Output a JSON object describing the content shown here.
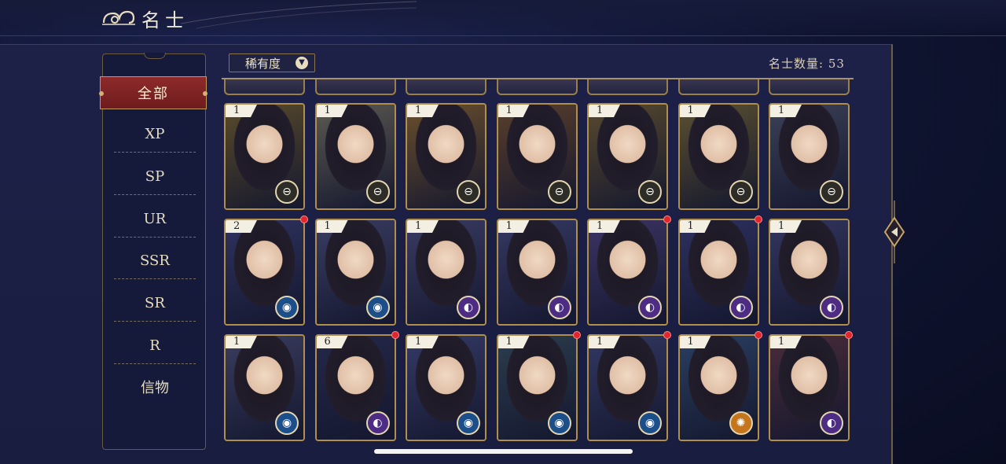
{
  "header": {
    "title": "名士"
  },
  "sidebar": {
    "items": [
      {
        "label": "全部",
        "active": true
      },
      {
        "label": "XP"
      },
      {
        "label": "SP"
      },
      {
        "label": "UR"
      },
      {
        "label": "SSR"
      },
      {
        "label": "SR"
      },
      {
        "label": "R"
      },
      {
        "label": "信物"
      }
    ]
  },
  "toolbar": {
    "sort_label": "稀有度",
    "count_label": "名士数量:",
    "count_value": "53"
  },
  "colors": {
    "accent_gold": "#b08f4d",
    "active_tab": "#8e2a2a",
    "notification": "#e3262d",
    "background": "#191d40"
  },
  "cards": [
    {
      "level": "1",
      "badge": "gold",
      "badge_icon": "sword-emblem-icon",
      "new": false,
      "tone": "#5a4b2a"
    },
    {
      "level": "1",
      "badge": "gold",
      "badge_icon": "sword-emblem-icon",
      "new": false,
      "tone": "#5c5a52"
    },
    {
      "level": "1",
      "badge": "gold",
      "badge_icon": "sword-emblem-icon",
      "new": false,
      "tone": "#6a4f2c"
    },
    {
      "level": "1",
      "badge": "gold",
      "badge_icon": "sword-emblem-icon",
      "new": false,
      "tone": "#5a3f2b"
    },
    {
      "level": "1",
      "badge": "gold",
      "badge_icon": "sword-emblem-icon",
      "new": false,
      "tone": "#584a2e"
    },
    {
      "level": "1",
      "badge": "gold",
      "badge_icon": "sword-emblem-icon",
      "new": false,
      "tone": "#5a5030"
    },
    {
      "level": "1",
      "badge": "gold",
      "badge_icon": "sword-emblem-icon",
      "new": false,
      "tone": "#3c4158"
    },
    {
      "level": "2",
      "badge": "blue",
      "badge_icon": "eye-emblem-icon",
      "new": true,
      "tone": "#2f3360"
    },
    {
      "level": "1",
      "badge": "blue",
      "badge_icon": "eye-emblem-icon",
      "new": false,
      "tone": "#3a3d62"
    },
    {
      "level": "1",
      "badge": "purple",
      "badge_icon": "moon-emblem-icon",
      "new": false,
      "tone": "#3a3b63"
    },
    {
      "level": "1",
      "badge": "purple",
      "badge_icon": "moon-emblem-icon",
      "new": false,
      "tone": "#363963"
    },
    {
      "level": "1",
      "badge": "purple",
      "badge_icon": "moon-emblem-icon",
      "new": true,
      "tone": "#3c3464"
    },
    {
      "level": "1",
      "badge": "purple",
      "badge_icon": "moon-emblem-icon",
      "new": true,
      "tone": "#2d3160"
    },
    {
      "level": "1",
      "badge": "purple",
      "badge_icon": "moon-emblem-icon",
      "new": false,
      "tone": "#33365e"
    },
    {
      "level": "1",
      "badge": "blue",
      "badge_icon": "eye-emblem-icon",
      "new": false,
      "tone": "#3a3d60"
    },
    {
      "level": "6",
      "badge": "purple",
      "badge_icon": "moon-emblem-icon",
      "new": true,
      "tone": "#25284a"
    },
    {
      "level": "1",
      "badge": "blue",
      "badge_icon": "eye-emblem-icon",
      "new": false,
      "tone": "#353a66"
    },
    {
      "level": "1",
      "badge": "blue",
      "badge_icon": "eye-emblem-icon",
      "new": true,
      "tone": "#2c3d4e"
    },
    {
      "level": "1",
      "badge": "blue",
      "badge_icon": "eye-emblem-icon",
      "new": true,
      "tone": "#333863"
    },
    {
      "level": "1",
      "badge": "orange",
      "badge_icon": "sun-emblem-icon",
      "new": true,
      "tone": "#2a3f62"
    },
    {
      "level": "1",
      "badge": "purple",
      "badge_icon": "moon-emblem-icon",
      "new": true,
      "tone": "#4a2c3a"
    }
  ]
}
